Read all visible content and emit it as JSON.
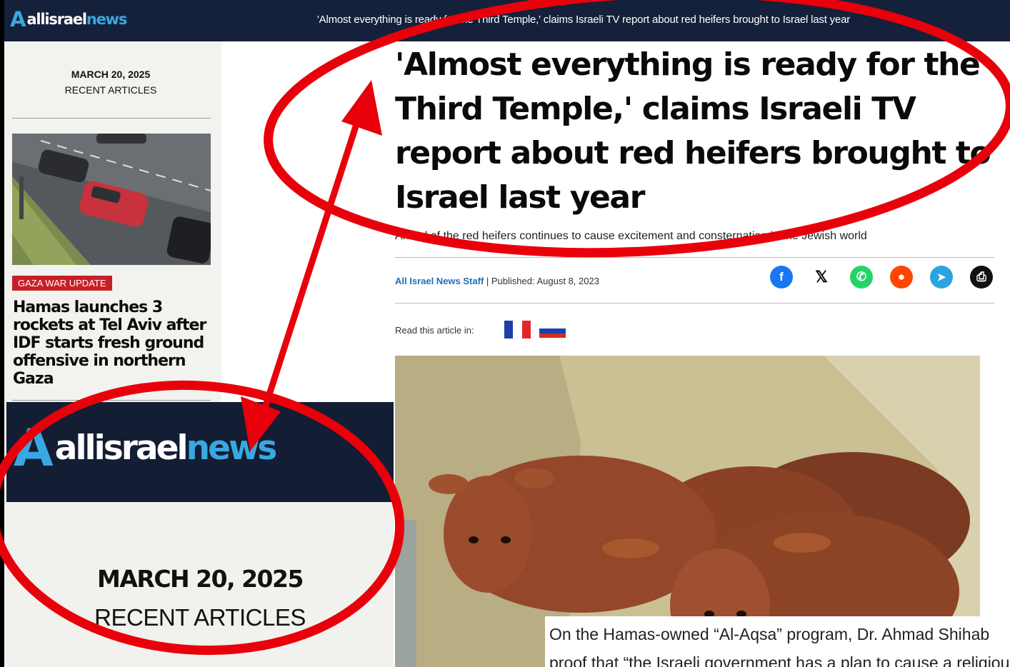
{
  "colors": {
    "navy": "#15213a",
    "accent": "#3aa8e0",
    "annotation": "#e8000a",
    "tag": "#c62026"
  },
  "header": {
    "logo_mark": "A",
    "logo_part1": "allisrael",
    "logo_part2": "news",
    "ticker": "'Almost everything is ready for the Third Temple,' claims Israeli TV report about red heifers brought to Israel last year"
  },
  "sidebar": {
    "date": "MARCH 20, 2025",
    "section": "RECENT ARTICLES",
    "article": {
      "image_alt": "cars-on-road-photo",
      "tag": "GAZA WAR UPDATE",
      "headline": "Hamas launches 3 rockets at Tel Aviv after IDF starts fresh ground offensive in northern Gaza"
    }
  },
  "article": {
    "headline": "'Almost everything is ready for the Third Temple,' claims Israeli TV report about red heifers brought to Israel last year",
    "subhead": "Arrival of the red heifers continues to cause excitement and consternation in the Jewish world",
    "author": "All Israel News Staff",
    "separator": " | ",
    "published": "Published: August 8, 2023",
    "read_in": "Read this article in:",
    "share": [
      {
        "name": "facebook-icon",
        "glyph": "f",
        "color": "#1877f2"
      },
      {
        "name": "x-icon",
        "glyph": "𝕏",
        "color": "#000000"
      },
      {
        "name": "whatsapp-icon",
        "glyph": "✆",
        "color": "#25d366"
      },
      {
        "name": "reddit-icon",
        "glyph": "●",
        "color": "#ff4500"
      },
      {
        "name": "telegram-icon",
        "glyph": "➤",
        "color": "#2aa3df"
      },
      {
        "name": "print-icon",
        "glyph": "⎙",
        "color": "#111111"
      }
    ],
    "flags": [
      "french-flag-icon",
      "russian-flag-icon"
    ],
    "hero_alt": "red-heifers-photo"
  },
  "zoom": {
    "logo_mark": "A",
    "logo_part1": "allisrael",
    "logo_part2": "news",
    "date": "MARCH 20, 2025",
    "section": "RECENT ARTICLES"
  },
  "quote": {
    "line1": "On the Hamas-owned “Al-Aqsa” program, Dr. Ahmad Shihab",
    "line2": "proof that “the Israeli government has a plan to cause a religious"
  }
}
